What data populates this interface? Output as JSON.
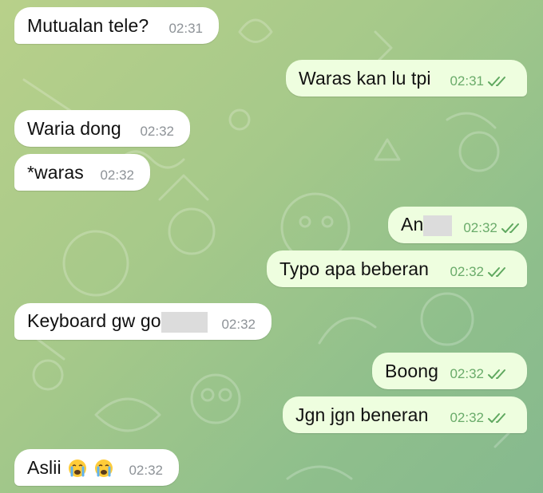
{
  "messages": [
    {
      "text": "Mutualan tele?",
      "time": "02:31",
      "dir": "in"
    },
    {
      "text": "Waras kan lu tpi",
      "time": "02:31",
      "dir": "out",
      "status": "read"
    },
    {
      "text": "Waria dong",
      "time": "02:32",
      "dir": "in"
    },
    {
      "text": "*waras",
      "time": "02:32",
      "dir": "in"
    },
    {
      "text": "An",
      "time": "02:32",
      "dir": "out",
      "status": "read",
      "redacted": true
    },
    {
      "text": "Typo apa beberan",
      "time": "02:32",
      "dir": "out",
      "status": "read"
    },
    {
      "text": "Keyboard gw go",
      "time": "02:32",
      "dir": "in",
      "redacted": true
    },
    {
      "text": "Boong",
      "time": "02:32",
      "dir": "out",
      "status": "read"
    },
    {
      "text": "Jgn jgn beneran",
      "time": "02:32",
      "dir": "out",
      "status": "read"
    },
    {
      "text": "Aslii",
      "time": "02:32",
      "dir": "in",
      "emoji": [
        "loudly-crying-face-icon",
        "loudly-crying-face-icon"
      ]
    }
  ],
  "colors": {
    "incoming_bubble": "#ffffff",
    "outgoing_bubble": "#eefedf",
    "outgoing_meta": "#6aab6a",
    "incoming_meta": "#8d9297"
  }
}
